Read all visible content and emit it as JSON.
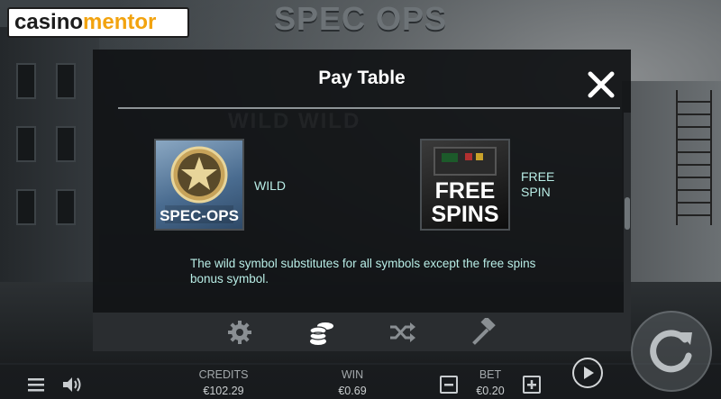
{
  "watermark": {
    "part1": "casino",
    "part2": "mentor"
  },
  "game_title": "SPEC OPS",
  "paytable": {
    "title": "Pay Table",
    "ghost_heading": "WILD WILD",
    "symbols": [
      {
        "name": "wild",
        "art_text": "SPEC-OPS",
        "label": "WILD"
      },
      {
        "name": "free-spins",
        "art_text_line1": "FREE",
        "art_text_line2": "SPINS",
        "label": "FREE SPIN"
      }
    ],
    "description": "The wild symbol substitutes for all symbols except the free spins bonus symbol."
  },
  "tabs": [
    {
      "name": "settings",
      "icon": "gear-icon"
    },
    {
      "name": "paytable",
      "icon": "coins-icon",
      "active": true
    },
    {
      "name": "random",
      "icon": "shuffle-icon"
    },
    {
      "name": "rules",
      "icon": "hammer-icon"
    }
  ],
  "bottom_bar": {
    "credits_label": "CREDITS",
    "credits_value": "€102.29",
    "win_label": "WIN",
    "win_value": "€0.69",
    "bet_label": "BET",
    "bet_value": "€0.20"
  },
  "colors": {
    "accent_text": "#b8ede6",
    "watermark_accent": "#f2a30f",
    "active_tab": "#ffffff",
    "inactive_tab": "#8a8f93"
  }
}
